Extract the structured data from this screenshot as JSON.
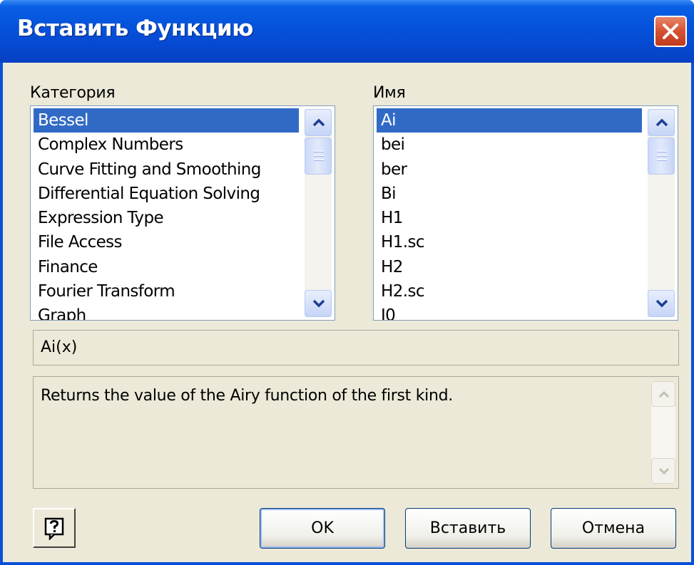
{
  "window": {
    "title": "Вставить Функцию"
  },
  "category": {
    "label": "Категория",
    "items": [
      "Bessel",
      "Complex Numbers",
      "Curve Fitting and Smoothing",
      "Differential Equation Solving",
      "Expression Type",
      "File Access",
      "Finance",
      "Fourier Transform",
      "Graph"
    ],
    "selected": "Bessel"
  },
  "name": {
    "label": "Имя",
    "items": [
      "Ai",
      "bei",
      "ber",
      "Bi",
      "H1",
      "H1.sc",
      "H2",
      "H2.sc",
      "I0"
    ],
    "selected": "Ai"
  },
  "syntax": "Ai(x)",
  "description": "Returns the value of the Airy function of the first kind.",
  "buttons": {
    "ok": "OK",
    "insert": "Вставить",
    "cancel": "Отмена"
  },
  "icons": {
    "close": "close-icon",
    "help": "help-icon",
    "scroll_up": "chevron-up-icon",
    "scroll_down": "chevron-down-icon"
  },
  "colors": {
    "titlebar": "#0553dc",
    "selection": "#316ac5",
    "dialog_bg": "#ece9d8",
    "close": "#d65032"
  }
}
